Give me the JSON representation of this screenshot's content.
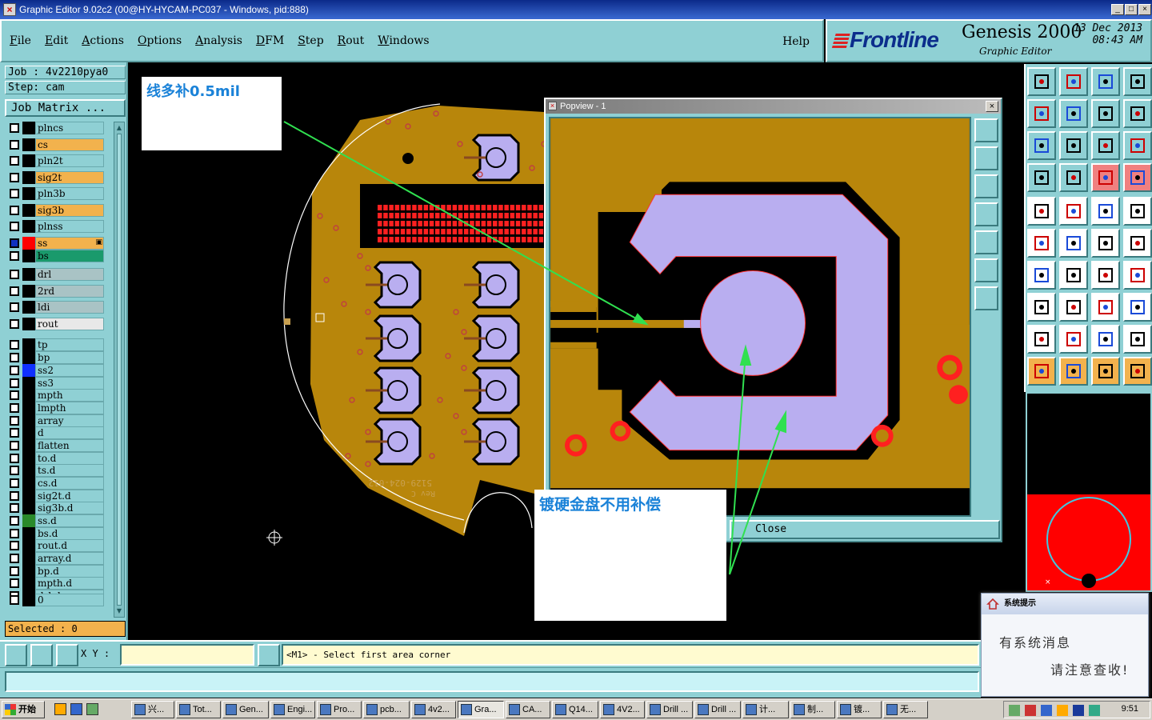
{
  "window": {
    "title": "Graphic Editor 9.02c2 (00@HY-HYCAM-PC037 - Windows, pid:888)",
    "icon": "editor-icon",
    "min": "_",
    "max": "□",
    "close": "×"
  },
  "menu": {
    "items": [
      "File",
      "Edit",
      "Actions",
      "Options",
      "Analysis",
      "DFM",
      "Step",
      "Rout",
      "Windows"
    ],
    "help": "Help"
  },
  "brand": {
    "logo": "Frontline",
    "product": "Genesis 2000",
    "subtitle": "Graphic Editor",
    "date": "13 Dec 2013",
    "time": "08:43 AM"
  },
  "job": {
    "job_label": "Job  : 4v2210pya0",
    "step_label": "Step: cam",
    "matrix_button": "Job Matrix ..."
  },
  "layers": [
    {
      "name": "plncs",
      "color": "#8fd0d4",
      "swatch": "#000000"
    },
    {
      "name": "cs",
      "color": "#f2b24d",
      "swatch": "#000000"
    },
    {
      "name": "pln2t",
      "color": "#8fd0d4",
      "swatch": "#000000"
    },
    {
      "name": "sig2t",
      "color": "#f2b24d",
      "swatch": "#000000"
    },
    {
      "name": "pln3b",
      "color": "#8fd0d4",
      "swatch": "#000000"
    },
    {
      "name": "sig3b",
      "color": "#f2b24d",
      "swatch": "#000000"
    },
    {
      "name": "plnss",
      "color": "#8fd0d4",
      "swatch": "#000000"
    },
    {
      "name": "ss",
      "color": "#f2b24d",
      "swatch": "#ff0000",
      "checked": true,
      "marker": "▣"
    },
    {
      "name": "bs",
      "color": "#1a9a6c",
      "swatch": "#000000"
    },
    {
      "name": "drl",
      "color": "#a9c3c5",
      "swatch": "#000000"
    },
    {
      "name": "2rd",
      "color": "#a9c3c5",
      "swatch": "#000000"
    },
    {
      "name": "ldi",
      "color": "#a9c3c5",
      "swatch": "#000000"
    },
    {
      "name": "rout",
      "color": "#e8e8e8",
      "swatch": "#000000"
    },
    {
      "name": "tp",
      "color": "#8fd0d4",
      "swatch": "#000000"
    },
    {
      "name": "bp",
      "color": "#8fd0d4",
      "swatch": "#000000"
    },
    {
      "name": "ss2",
      "color": "#8fd0d4",
      "swatch": "#1030ff"
    },
    {
      "name": "ss3",
      "color": "#8fd0d4",
      "swatch": "#000000"
    },
    {
      "name": "mpth",
      "color": "#8fd0d4",
      "swatch": "#000000"
    },
    {
      "name": "lmpth",
      "color": "#8fd0d4",
      "swatch": "#000000"
    },
    {
      "name": "array",
      "color": "#8fd0d4",
      "swatch": "#000000"
    },
    {
      "name": "d",
      "color": "#8fd0d4",
      "swatch": "#000000"
    },
    {
      "name": "flatten",
      "color": "#8fd0d4",
      "swatch": "#000000"
    },
    {
      "name": "to.d",
      "color": "#8fd0d4",
      "swatch": "#000000"
    },
    {
      "name": "ts.d",
      "color": "#8fd0d4",
      "swatch": "#000000"
    },
    {
      "name": "cs.d",
      "color": "#8fd0d4",
      "swatch": "#000000"
    },
    {
      "name": "sig2t.d",
      "color": "#8fd0d4",
      "swatch": "#000000"
    },
    {
      "name": "sig3b.d",
      "color": "#8fd0d4",
      "swatch": "#000000"
    },
    {
      "name": "ss.d",
      "color": "#8fd0d4",
      "swatch": "#2a8a2a"
    },
    {
      "name": "bs.d",
      "color": "#8fd0d4",
      "swatch": "#000000"
    },
    {
      "name": "rout.d",
      "color": "#8fd0d4",
      "swatch": "#000000"
    },
    {
      "name": "array.d",
      "color": "#8fd0d4",
      "swatch": "#000000"
    },
    {
      "name": "bp.d",
      "color": "#8fd0d4",
      "swatch": "#000000"
    },
    {
      "name": "mpth.d",
      "color": "#8fd0d4",
      "swatch": "#000000"
    },
    {
      "name": "drl.d",
      "color": "#8fd0d4",
      "swatch": "#000000"
    },
    {
      "name": "0",
      "color": "#8fd0d4",
      "swatch": "#000000"
    }
  ],
  "selected": "Selected : 0",
  "board": {
    "text_part": "5129-024-012",
    "text_rev": "Rev C",
    "copper": "#b8860b",
    "pad": "#b9aef0"
  },
  "popview": {
    "title": "Popview - 1",
    "close_button": "Close"
  },
  "notes": {
    "note1": "线多补0.5mil",
    "note2": "镀硬金盘不用补偿"
  },
  "status": {
    "xy_label": "X Y :",
    "xy_value": "",
    "prompt": "<M1> - Select first area corner"
  },
  "notify": {
    "title": "系统提示",
    "line1": "有系统消息",
    "line2": "请注意查收!"
  },
  "taskbar": {
    "start": "开始",
    "items": [
      "兴...",
      "Tot...",
      "Gen...",
      "Engi...",
      "Pro...",
      "pcb...",
      "4v2...",
      "Gra...",
      "CA...",
      "Q14...",
      "4V2...",
      "Drill ...",
      "Drill ...",
      "计...",
      "制...",
      "镀...",
      "无..."
    ],
    "clock": "9:51"
  }
}
